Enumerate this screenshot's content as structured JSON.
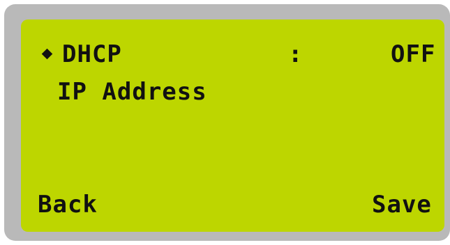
{
  "screen": {
    "menu": {
      "dhcp": {
        "label": "DHCP",
        "separator": ":",
        "value": "OFF",
        "selected": true
      },
      "ip_address": {
        "label": "IP Address"
      }
    },
    "softkeys": {
      "left": "Back",
      "right": "Save"
    },
    "icons": {
      "selector": "diamond-selector-icon"
    },
    "colors": {
      "lcd_background": "#bdd600",
      "frame": "#b9b9b9",
      "text": "#111111"
    }
  }
}
